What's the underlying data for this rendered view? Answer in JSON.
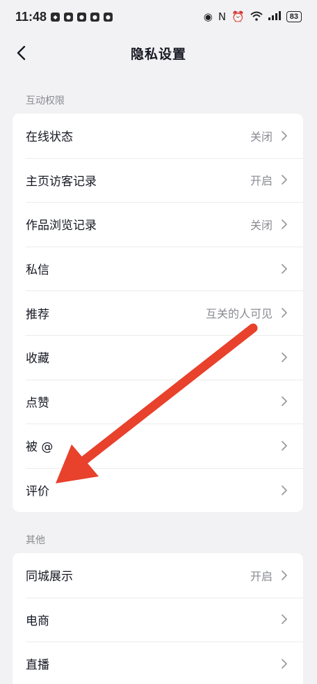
{
  "status_bar": {
    "time": "11:48",
    "battery": "83"
  },
  "header": {
    "title": "隐私设置"
  },
  "sections": [
    {
      "label": "互动权限",
      "items": [
        {
          "label": "在线状态",
          "value": "关闭"
        },
        {
          "label": "主页访客记录",
          "value": "开启"
        },
        {
          "label": "作品浏览记录",
          "value": "关闭"
        },
        {
          "label": "私信",
          "value": ""
        },
        {
          "label": "推荐",
          "value": "互关的人可见"
        },
        {
          "label": "收藏",
          "value": ""
        },
        {
          "label": "点赞",
          "value": ""
        },
        {
          "label": "被 @",
          "value": ""
        },
        {
          "label": "评价",
          "value": ""
        }
      ]
    },
    {
      "label": "其他",
      "items": [
        {
          "label": "同城展示",
          "value": "开启"
        },
        {
          "label": "电商",
          "value": ""
        },
        {
          "label": "直播",
          "value": ""
        }
      ]
    }
  ],
  "annotation": {
    "arrow_color": "#e8412c"
  }
}
